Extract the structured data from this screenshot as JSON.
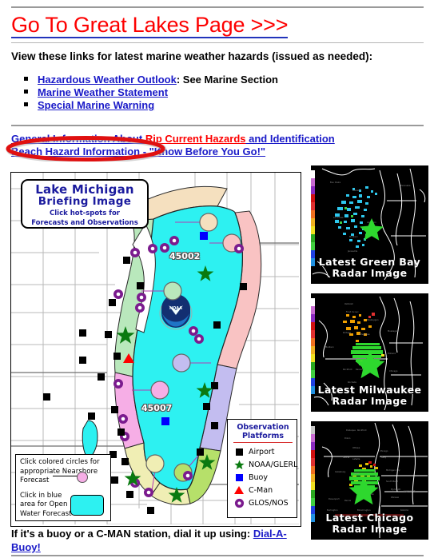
{
  "header": {
    "title_link": "Go To Great Lakes Page >>>",
    "title_color": "#fd0000",
    "link_color": "#1a1ac8",
    "intro": "View these links for latest marine weather hazards (issued as needed):"
  },
  "hazard_links": [
    {
      "link": "Hazardous Weather Outlook",
      "tail": ": See Marine Section"
    },
    {
      "link": "Marine Weather Statement",
      "tail": ""
    },
    {
      "link": "Special Marine Warning",
      "tail": ""
    }
  ],
  "secondary_links": [
    {
      "blue": "General Information About ",
      "red": "Rip Current Hazards",
      "blue2": " and Identification"
    },
    {
      "blue": "Beach Hazard Information - \"Know Before You Go!\"",
      "red": "",
      "blue2": ""
    }
  ],
  "annotation": {
    "shape": "ellipse",
    "color": "#e01010",
    "target": "Beach Hazard Information - \"Know Before You Go!\""
  },
  "map": {
    "callout": {
      "line1": "Lake Michigan",
      "line2": "Briefing Image",
      "line3a": "Click hot-spots for",
      "line3b": "Forecasts and Observations",
      "text_color": "#1b1b9e"
    },
    "buoy_labels": [
      "45002",
      "45007"
    ],
    "nearshore_legend": {
      "line1": "Click colored circles for",
      "line2": "appropriate Nearshore",
      "line3": "Forecast",
      "line4": "Click in blue",
      "line5": "area for Open",
      "line6": "Water Forecast",
      "swatch_color": "#2df1f1",
      "circle_color": "#f6aee6"
    },
    "observation_legend": {
      "title_line1": "Observation",
      "title_line2": "Platforms",
      "items": [
        {
          "label": "Airport",
          "glyph": "square",
          "color": "#000000"
        },
        {
          "label": "NOAA/GLERL",
          "glyph": "star",
          "color": "#0a7a10"
        },
        {
          "label": "Buoy",
          "glyph": "square",
          "color": "#0000ff"
        },
        {
          "label": "C-Man",
          "glyph": "triangle",
          "color": "#ff0000"
        },
        {
          "label": "GLOS/NOS",
          "glyph": "circle-ring",
          "color": "#7b1b8e"
        }
      ]
    },
    "water_color": "#2df1f1",
    "zone_colors": [
      "#b9e8bc",
      "#f9c3c3",
      "#f6aee6",
      "#c3bdf0",
      "#f0eeb4",
      "#b6e06a",
      "#f5e0bf"
    ]
  },
  "radar_panels": [
    {
      "caption_line1": "Latest Green Bay",
      "caption_line2": "Radar Image",
      "echo_color": "#2ec8ee"
    },
    {
      "caption_line1": "Latest Milwaukee",
      "caption_line2": "Radar Image",
      "echo_color": "#f0a000"
    },
    {
      "caption_line1": "Latest Chicago",
      "caption_line2": "Radar Image",
      "echo_color": "#e0c000"
    }
  ],
  "footer": {
    "text_before": "If it's a buoy or a C-MAN station, dial it up using: ",
    "link": "Dial-A-Buoy!"
  }
}
